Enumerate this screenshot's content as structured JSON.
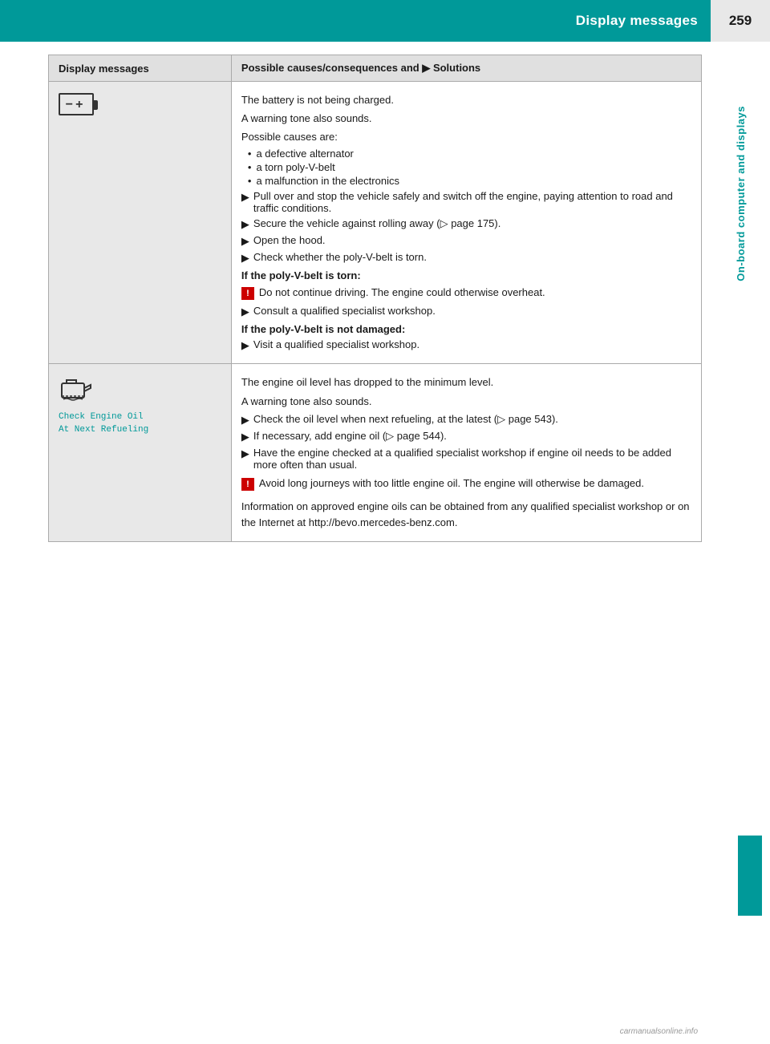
{
  "header": {
    "title": "Display messages",
    "page_number": "259"
  },
  "sidebar": {
    "rotated_label": "On-board computer and displays"
  },
  "table": {
    "col1_header": "Display messages",
    "col2_header": "Possible causes/consequences and ▶ Solutions",
    "rows": [
      {
        "id": "battery-row",
        "icon_type": "battery",
        "content": {
          "lines": [
            {
              "type": "para",
              "text": "The battery is not being charged."
            },
            {
              "type": "para",
              "text": "A warning tone also sounds."
            },
            {
              "type": "para",
              "text": "Possible causes are:"
            },
            {
              "type": "bullet",
              "text": "a defective alternator"
            },
            {
              "type": "bullet",
              "text": "a torn poly-V-belt"
            },
            {
              "type": "bullet",
              "text": "a malfunction in the electronics"
            },
            {
              "type": "arrow",
              "text": "Pull over and stop the vehicle safely and switch off the engine, paying attention to road and traffic conditions."
            },
            {
              "type": "arrow",
              "text": "Secure the vehicle against rolling away (▷ page 175)."
            },
            {
              "type": "arrow",
              "text": "Open the hood."
            },
            {
              "type": "arrow",
              "text": "Check whether the poly-V-belt is torn."
            },
            {
              "type": "bold",
              "text": "If the poly-V-belt is torn:"
            },
            {
              "type": "warning",
              "text": "Do not continue driving. The engine could otherwise overheat."
            },
            {
              "type": "arrow",
              "text": "Consult a qualified specialist workshop."
            },
            {
              "type": "bold",
              "text": "If the poly-V-belt is not damaged:"
            },
            {
              "type": "arrow",
              "text": "Visit a qualified specialist workshop."
            }
          ]
        }
      },
      {
        "id": "oil-row",
        "icon_type": "oil",
        "icon_label": "Check Engine Oil\nAt Next Refueling",
        "content": {
          "lines": [
            {
              "type": "para",
              "text": "The engine oil level has dropped to the minimum level."
            },
            {
              "type": "para",
              "text": "A warning tone also sounds."
            },
            {
              "type": "arrow",
              "text": "Check the oil level when next refueling, at the latest (▷ page 543)."
            },
            {
              "type": "arrow",
              "text": "If necessary, add engine oil (▷ page 544)."
            },
            {
              "type": "arrow",
              "text": "Have the engine checked at a qualified specialist workshop if engine oil needs to be added more often than usual."
            },
            {
              "type": "warning",
              "text": "Avoid long journeys with too little engine oil. The engine will otherwise be damaged."
            },
            {
              "type": "para",
              "text": "Information on approved engine oils can be obtained from any qualified specialist workshop or on the Internet at http://bevo.mercedes-benz.com."
            }
          ]
        }
      }
    ]
  },
  "watermark": "carmanualsonline.info"
}
